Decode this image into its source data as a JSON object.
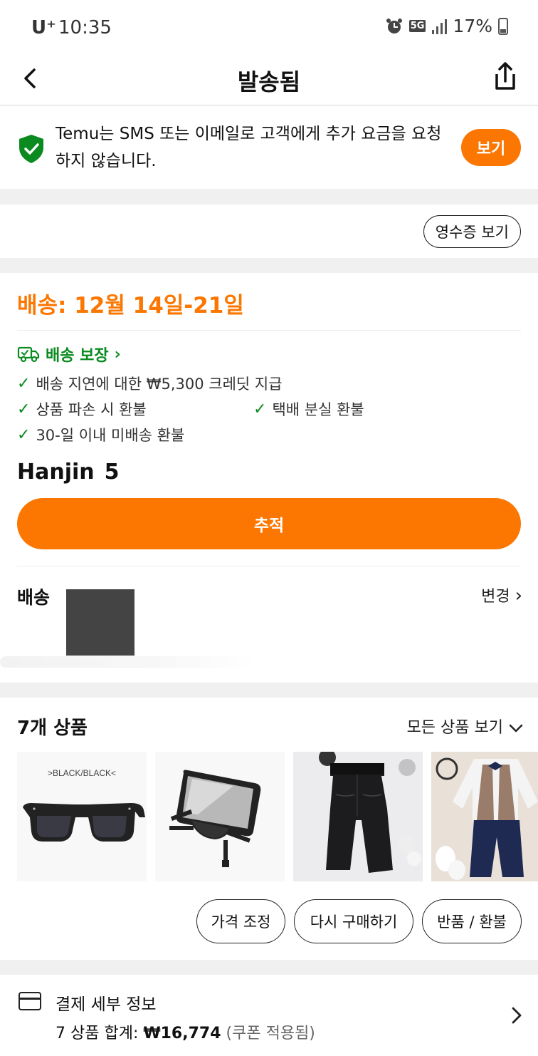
{
  "status_bar": {
    "carrier": "U⁺",
    "time": "10:35",
    "network": "5G",
    "battery": "17%"
  },
  "header": {
    "title": "발송됨"
  },
  "notice": {
    "text": "Temu는 SMS 또는 이메일로 고객에게 추가 요금을 요청하지 않습니다.",
    "button": "보기"
  },
  "receipt": {
    "button": "영수증 보기"
  },
  "delivery": {
    "eta": "배송: 12월 14일-21일",
    "guarantee_title": "배송 보장",
    "perks": [
      "배송 지연에 대한 ₩5,300 크레딧 지급",
      "상품 파손 시 환불",
      "택배 분실 환불",
      "30-일 이내 미배송 환불"
    ],
    "carrier": "Hanjin",
    "tracking_partial": "5",
    "track_button": "추적",
    "ship_label": "배송",
    "change_link": "변경"
  },
  "products": {
    "title": "7개 상품",
    "view_all": "모든 상품 보기",
    "thumb_label": ">BLACK/BLACK<",
    "actions": [
      "가격 조정",
      "다시 구매하기",
      "반품 / 환불"
    ]
  },
  "payment": {
    "title": "결제 세부 정보",
    "summary_prefix": "7 상품 합계:",
    "total": "₩16,774",
    "coupon_note": "(쿠폰 적용됨)"
  },
  "colors": {
    "accent": "#fb7701",
    "green": "#0a8a1f"
  }
}
